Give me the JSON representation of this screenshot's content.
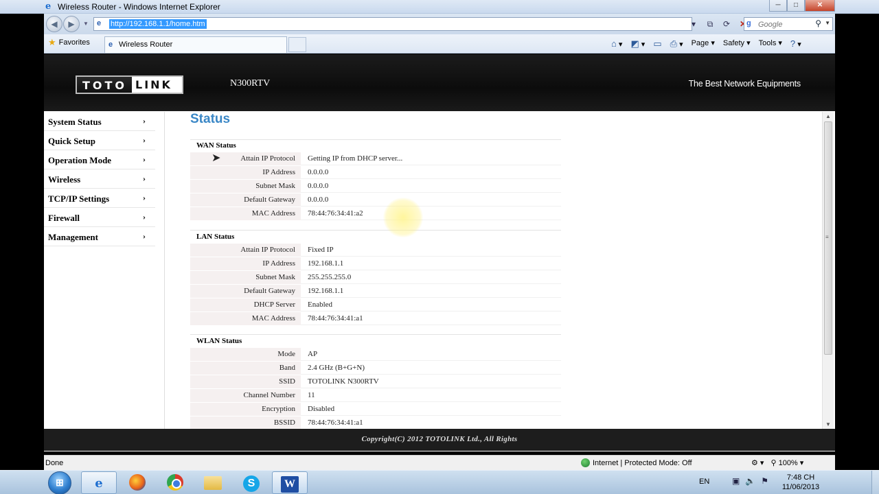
{
  "window": {
    "title": "Wireless Router - Windows Internet Explorer",
    "minimize": "─",
    "maximize": "□",
    "close": "✕"
  },
  "browser": {
    "url": "http://192.168.1.1/home.htm",
    "search_placeholder": "Google",
    "favorites_label": "Favorites",
    "tab_title": "Wireless Router",
    "commands": {
      "page": "Page",
      "safety": "Safety",
      "tools": "Tools"
    }
  },
  "router": {
    "logo_left": "TOTO",
    "logo_right": "LINK",
    "model": "N300RTV",
    "slogan": "The Best Network Equipments",
    "page_title": "Status",
    "copyright": "Copyright(C) 2012 TOTOLINK Ltd., All Rights"
  },
  "sidebar": {
    "items": [
      {
        "label": "System Status"
      },
      {
        "label": "Quick Setup"
      },
      {
        "label": "Operation Mode"
      },
      {
        "label": "Wireless"
      },
      {
        "label": "TCP/IP Settings"
      },
      {
        "label": "Firewall"
      },
      {
        "label": "Management"
      }
    ]
  },
  "sections": {
    "wan": {
      "title": "WAN Status",
      "rows": [
        {
          "label": "Attain IP Protocol",
          "value": "Getting IP from DHCP server..."
        },
        {
          "label": "IP Address",
          "value": "0.0.0.0"
        },
        {
          "label": "Subnet Mask",
          "value": "0.0.0.0"
        },
        {
          "label": "Default Gateway",
          "value": "0.0.0.0"
        },
        {
          "label": "MAC Address",
          "value": "78:44:76:34:41:a2"
        }
      ]
    },
    "lan": {
      "title": "LAN Status",
      "rows": [
        {
          "label": "Attain IP Protocol",
          "value": "Fixed IP"
        },
        {
          "label": "IP Address",
          "value": "192.168.1.1"
        },
        {
          "label": "Subnet Mask",
          "value": "255.255.255.0"
        },
        {
          "label": "Default Gateway",
          "value": "192.168.1.1"
        },
        {
          "label": "DHCP Server",
          "value": "Enabled"
        },
        {
          "label": "MAC Address",
          "value": "78:44:76:34:41:a1"
        }
      ]
    },
    "wlan": {
      "title": "WLAN Status",
      "rows": [
        {
          "label": "Mode",
          "value": "AP"
        },
        {
          "label": "Band",
          "value": "2.4 GHz (B+G+N)"
        },
        {
          "label": "SSID",
          "value": "TOTOLINK N300RTV"
        },
        {
          "label": "Channel Number",
          "value": "11"
        },
        {
          "label": "Encryption",
          "value": "Disabled"
        },
        {
          "label": "BSSID",
          "value": "78:44:76:34:41:a1"
        }
      ]
    }
  },
  "statusbar": {
    "left": "Done",
    "zone": "Internet | Protected Mode: Off",
    "zoom": "100%"
  },
  "taskbar": {
    "language": "EN",
    "time": "7:48 CH",
    "date": "11/06/2013",
    "word_letter": "W",
    "skype_letter": "S"
  },
  "colors": {
    "accent": "#3a87c6",
    "header_bg": "#111111",
    "label_bg": "#f5f0f0"
  }
}
